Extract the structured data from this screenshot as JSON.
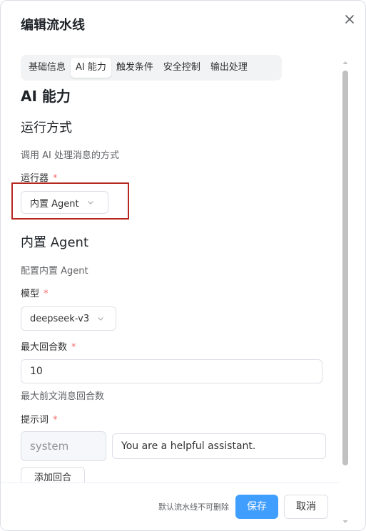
{
  "dialog": {
    "title": "编辑流水线"
  },
  "tabs": [
    {
      "label": "基础信息",
      "active": false
    },
    {
      "label": "AI 能力",
      "active": true
    },
    {
      "label": "触发条件",
      "active": false
    },
    {
      "label": "安全控制",
      "active": false
    },
    {
      "label": "输出处理",
      "active": false
    }
  ],
  "section": {
    "title": "AI 能力"
  },
  "run_mode": {
    "title": "运行方式",
    "desc": "调用 AI 处理消息的方式",
    "runner_label": "运行器",
    "required_mark": "*",
    "runner_value": "内置 Agent"
  },
  "agent": {
    "title": "内置 Agent",
    "desc": "配置内置 Agent",
    "model_label": "模型",
    "model_value": "deepseek-v3",
    "max_rounds_label": "最大回合数",
    "max_rounds_value": "10",
    "max_rounds_hint": "最大前文消息回合数",
    "prompt_label": "提示词",
    "prompt_role": "system",
    "prompt_content": "You are a helpful assistant.",
    "add_round_label": "添加回合"
  },
  "footer": {
    "note": "默认流水线不可删除",
    "save_label": "保存",
    "cancel_label": "取消"
  },
  "icons": {
    "close": "close-icon",
    "chevron": "chevron-down-icon",
    "scroll_up": "scroll-up-arrow-icon",
    "scroll_down": "scroll-down-arrow-icon"
  },
  "colors": {
    "primary": "#409eff",
    "required": "#f56c6c",
    "highlight": "#b5261e"
  }
}
